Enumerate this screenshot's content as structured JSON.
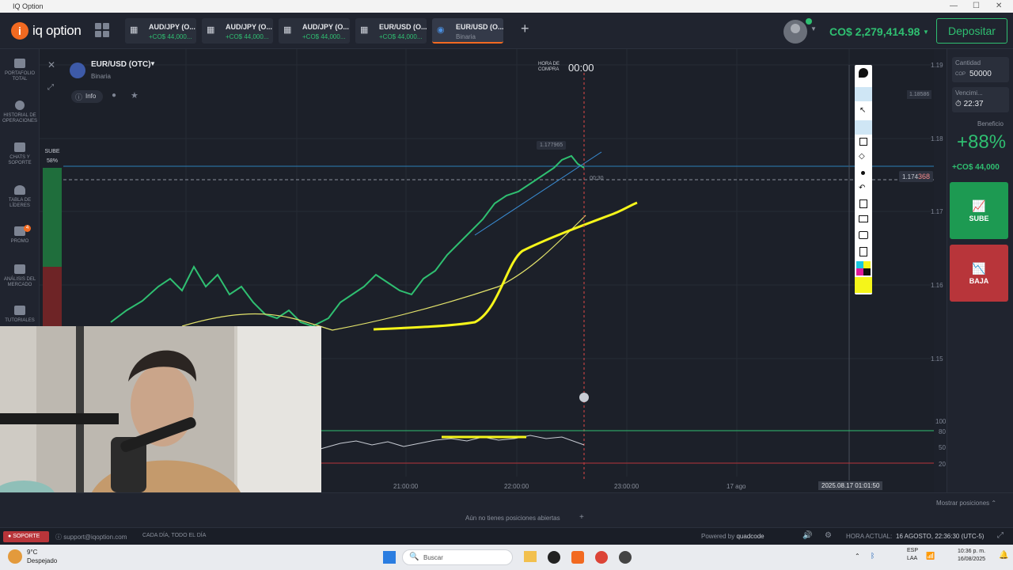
{
  "window": {
    "title": "IQ Option"
  },
  "header": {
    "logo": "iq option",
    "tabs": [
      {
        "name": "AUD/JPY (O...",
        "sub": "+CO$ 44,000..."
      },
      {
        "name": "AUD/JPY (O...",
        "sub": "+CO$ 44,000..."
      },
      {
        "name": "AUD/JPY (O...",
        "sub": "+CO$ 44,000..."
      },
      {
        "name": "EUR/USD (O...",
        "sub": "+CO$ 44,000..."
      },
      {
        "name": "EUR/USD (O...",
        "sub": "Binaria"
      }
    ],
    "balance": "CO$ 2,279,414.98",
    "deposit_label": "Depositar"
  },
  "sidebar": {
    "items": [
      {
        "label": "PORTAFOLIO TOTAL"
      },
      {
        "label": "HISTORIAL DE OPERACIONES"
      },
      {
        "label": "CHATS Y SOPORTE"
      },
      {
        "label": "TABLA DE LÍDERES"
      },
      {
        "label": "PROMO",
        "badge": "4"
      },
      {
        "label": "ANÁLISIS DEL MERCADO"
      },
      {
        "label": "TUTORIALES"
      }
    ]
  },
  "chart": {
    "asset": "EUR/USD (OTC)",
    "asset_type": "Binaria",
    "info_label": "Info",
    "buy_time_label": "HORA DE COMPRA",
    "buy_time": "00:00",
    "sentiment_label": "SUBE",
    "sentiment_value": "58%",
    "price_marker": "1.177965",
    "current_price_prefix": "1.174",
    "current_price_suffix": "368",
    "timer": "00:30",
    "alert_price": "1.18586",
    "y_ticks": [
      "1.19",
      "1.18",
      "1.17",
      "1.16",
      "1.15"
    ],
    "x_ticks": [
      "21:00:00",
      "22:00:00",
      "23:00:00",
      "17 ago"
    ],
    "x_cursor_label": "2025.08.17 01:01:50",
    "osc_ticks": [
      "100",
      "80",
      "50",
      "20"
    ]
  },
  "right_panel": {
    "amount_label": "Cantidad",
    "amount_currency": "COP",
    "amount_value": "50000",
    "expiry_label": "Vencimi...",
    "expiry_value": "22:37",
    "profit_label": "Beneficio",
    "profit_percent": "+88%",
    "profit_value": "+CO$ 44,000",
    "up_label": "SUBE",
    "down_label": "BAJA"
  },
  "positions": {
    "none_label": "Aún no tienes posiciones abiertas",
    "show_label": "Mostrar posiciones"
  },
  "footer": {
    "support": "SOPORTE",
    "email": "support@iqoption.com",
    "schedule": "CADA DÍA, TODO EL DÍA",
    "powered": "Powered by",
    "powered_brand": "quadcode",
    "time_label": "HORA ACTUAL:",
    "time_value": "16 AGOSTO, 22:36:30 (UTC-5)"
  },
  "taskbar": {
    "weather_temp": "9°C",
    "weather_desc": "Despejado",
    "search_placeholder": "Buscar",
    "lang": "ESP",
    "lang2": "LAA",
    "clock_time": "10:36 p. m.",
    "clock_date": "16/08/2025"
  },
  "colors": {
    "accent": "#f26a21",
    "green": "#2fbf71",
    "red": "#b8353a",
    "yellow": "#f5f51a"
  }
}
